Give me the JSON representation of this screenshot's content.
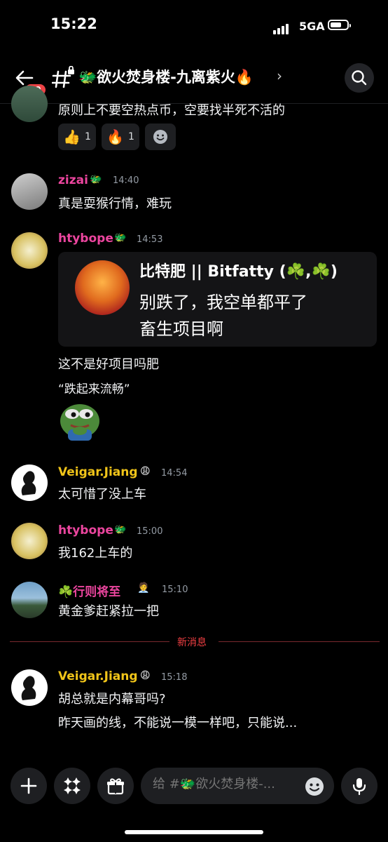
{
  "status_bar": {
    "time": "15:22",
    "network": "5GA"
  },
  "header": {
    "unread_count": "99",
    "channel_name": "🐲欲火焚身楼-九离紫火🔥",
    "chevron": "›"
  },
  "messages": {
    "partial": {
      "text": "原则上不要空热点币，空要找半死不活的",
      "reactions": [
        {
          "emoji": "👍",
          "count": "1"
        },
        {
          "emoji": "🔥",
          "count": "1"
        }
      ]
    },
    "m1": {
      "user": "zizai",
      "tag": "🐲",
      "time": "14:40",
      "text": "真是耍猴行情，难玩"
    },
    "m2": {
      "user": "htybope",
      "tag": "🐲",
      "time": "14:53",
      "embed": {
        "author": "比特肥 || Bitfatty (☘️,☘️)",
        "line1": "别跌了，我空单都平了",
        "line2": "畜生项目啊"
      },
      "text1": "这不是好项目吗肥",
      "text2": "“跌起来流畅”"
    },
    "m3": {
      "user": "Veigar.Jiang",
      "tag": "😩",
      "time": "14:54",
      "text": "太可惜了没上车"
    },
    "m4": {
      "user": "htybope",
      "tag": "🐲",
      "time": "15:00",
      "text": "我162上车的"
    },
    "m5": {
      "user": "☘️行则将至",
      "tag": "🧑‍💼",
      "time": "15:10",
      "text": "黄金爹赶紧拉一把"
    },
    "new_label": "新消息",
    "m6": {
      "user": "Veigar.Jiang",
      "tag": "😩",
      "time": "15:18",
      "text1": "胡总就是内幕哥吗?",
      "text2": "昨天画的线，不能说一模一样吧，只能说..."
    }
  },
  "composer": {
    "placeholder": "给 #🐲欲火焚身楼-..."
  },
  "colors": {
    "background": "#000000",
    "username_pink": "#eb459e",
    "username_yellow": "#f0c419",
    "new_messages_red": "#f23f43",
    "surface": "#1e1f22"
  }
}
